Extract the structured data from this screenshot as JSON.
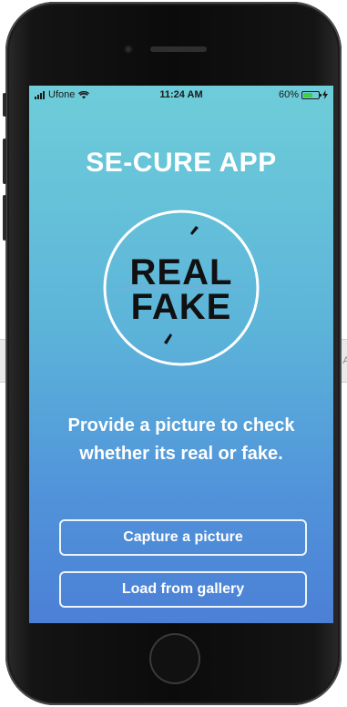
{
  "status_bar": {
    "carrier": "Ufone",
    "time": "11:24 AM",
    "battery_percent": "60%",
    "battery_level": 0.6,
    "battery_color": "#3fd04a",
    "icons": [
      "signal-bars-icon",
      "wifi-icon",
      "battery-icon",
      "charging-bolt-icon"
    ]
  },
  "app": {
    "title": "SE-CURE APP",
    "logo": {
      "top_word": "REAL",
      "bottom_word": "FAKE"
    },
    "message": "Provide a picture to check whether its real or fake.",
    "buttons": {
      "capture": "Capture a picture",
      "gallery": "Load from gallery"
    }
  },
  "colors": {
    "gradient_top": "#6ecdd9",
    "gradient_bottom": "#4c80d6",
    "text": "#ffffff"
  }
}
